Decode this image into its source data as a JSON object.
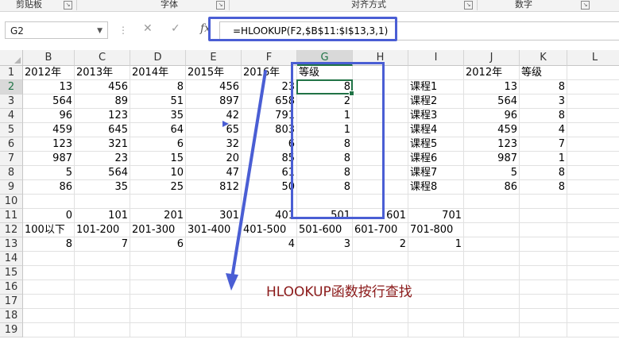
{
  "ribbon": {
    "groups": [
      "剪贴板",
      "字体",
      "对齐方式",
      "数字"
    ],
    "launcher": "↘"
  },
  "formula_bar": {
    "name_box": "G2",
    "cancel_icon": "✕",
    "enter_icon": "✓",
    "fx_label": "fx",
    "formula": "=HLOOKUP(F2,$B$11:$I$13,3,1)"
  },
  "columns": [
    "B",
    "C",
    "D",
    "E",
    "F",
    "G",
    "H",
    "I",
    "J",
    "K",
    "L"
  ],
  "selected_column": "G",
  "selected_row": "2",
  "rows": [
    {
      "n": "1",
      "cells": {
        "B": "2012年",
        "C": "2013年",
        "D": "2014年",
        "E": "2015年",
        "F": "2016年",
        "G": "等级",
        "J": "2012年",
        "K": "等级"
      }
    },
    {
      "n": "2",
      "cells": {
        "B": "13",
        "C": "456",
        "D": "8",
        "E": "456",
        "F": "23",
        "G": "8",
        "I": "课程1",
        "J": "13",
        "K": "8"
      }
    },
    {
      "n": "3",
      "cells": {
        "B": "564",
        "C": "89",
        "D": "51",
        "E": "897",
        "F": "658",
        "G": "2",
        "I": "课程2",
        "J": "564",
        "K": "3"
      }
    },
    {
      "n": "4",
      "cells": {
        "B": "96",
        "C": "123",
        "D": "35",
        "E": "42",
        "F": "791",
        "G": "1",
        "I": "课程3",
        "J": "96",
        "K": "8"
      }
    },
    {
      "n": "5",
      "cells": {
        "B": "459",
        "C": "645",
        "D": "64",
        "E": "65",
        "F": "803",
        "G": "1",
        "I": "课程4",
        "J": "459",
        "K": "4"
      }
    },
    {
      "n": "6",
      "cells": {
        "B": "123",
        "C": "321",
        "D": "6",
        "E": "32",
        "F": "6",
        "G": "8",
        "I": "课程5",
        "J": "123",
        "K": "7"
      }
    },
    {
      "n": "7",
      "cells": {
        "B": "987",
        "C": "23",
        "D": "15",
        "E": "20",
        "F": "85",
        "G": "8",
        "I": "课程6",
        "J": "987",
        "K": "1"
      }
    },
    {
      "n": "8",
      "cells": {
        "B": "5",
        "C": "564",
        "D": "10",
        "E": "47",
        "F": "61",
        "G": "8",
        "I": "课程7",
        "J": "5",
        "K": "8"
      }
    },
    {
      "n": "9",
      "cells": {
        "B": "86",
        "C": "35",
        "D": "25",
        "E": "812",
        "F": "50",
        "G": "8",
        "I": "课程8",
        "J": "86",
        "K": "8"
      }
    },
    {
      "n": "10",
      "cells": {}
    },
    {
      "n": "11",
      "cells": {
        "B": "0",
        "C": "101",
        "D": "201",
        "E": "301",
        "F": "401",
        "G": "501",
        "H": "601",
        "I": "701"
      }
    },
    {
      "n": "12",
      "cells": {
        "B": "100以下",
        "C": "101-200",
        "D": "201-300",
        "E": "301-400",
        "F": "401-500",
        "G": "501-600",
        "H": "601-700",
        "I": "701-800"
      }
    },
    {
      "n": "13",
      "cells": {
        "B": "8",
        "C": "7",
        "D": "6",
        "F": "4",
        "G": "3",
        "H": "2",
        "I": "1"
      }
    },
    {
      "n": "14",
      "cells": {}
    },
    {
      "n": "15",
      "cells": {}
    },
    {
      "n": "16",
      "cells": {}
    },
    {
      "n": "17",
      "cells": {}
    },
    {
      "n": "18",
      "cells": {}
    },
    {
      "n": "19",
      "cells": {}
    }
  ],
  "text_cells": [
    "B1",
    "C1",
    "D1",
    "E1",
    "F1",
    "G1",
    "J1",
    "K1",
    "I2",
    "I3",
    "I4",
    "I5",
    "I6",
    "I7",
    "I8",
    "I9",
    "B12",
    "C12",
    "D12",
    "E12",
    "F12",
    "G12",
    "H12",
    "I12"
  ],
  "annotation": {
    "caption": "HLOOKUP函数按行查找",
    "color": "#4a5ed4",
    "caption_color": "#8b1a1a"
  }
}
